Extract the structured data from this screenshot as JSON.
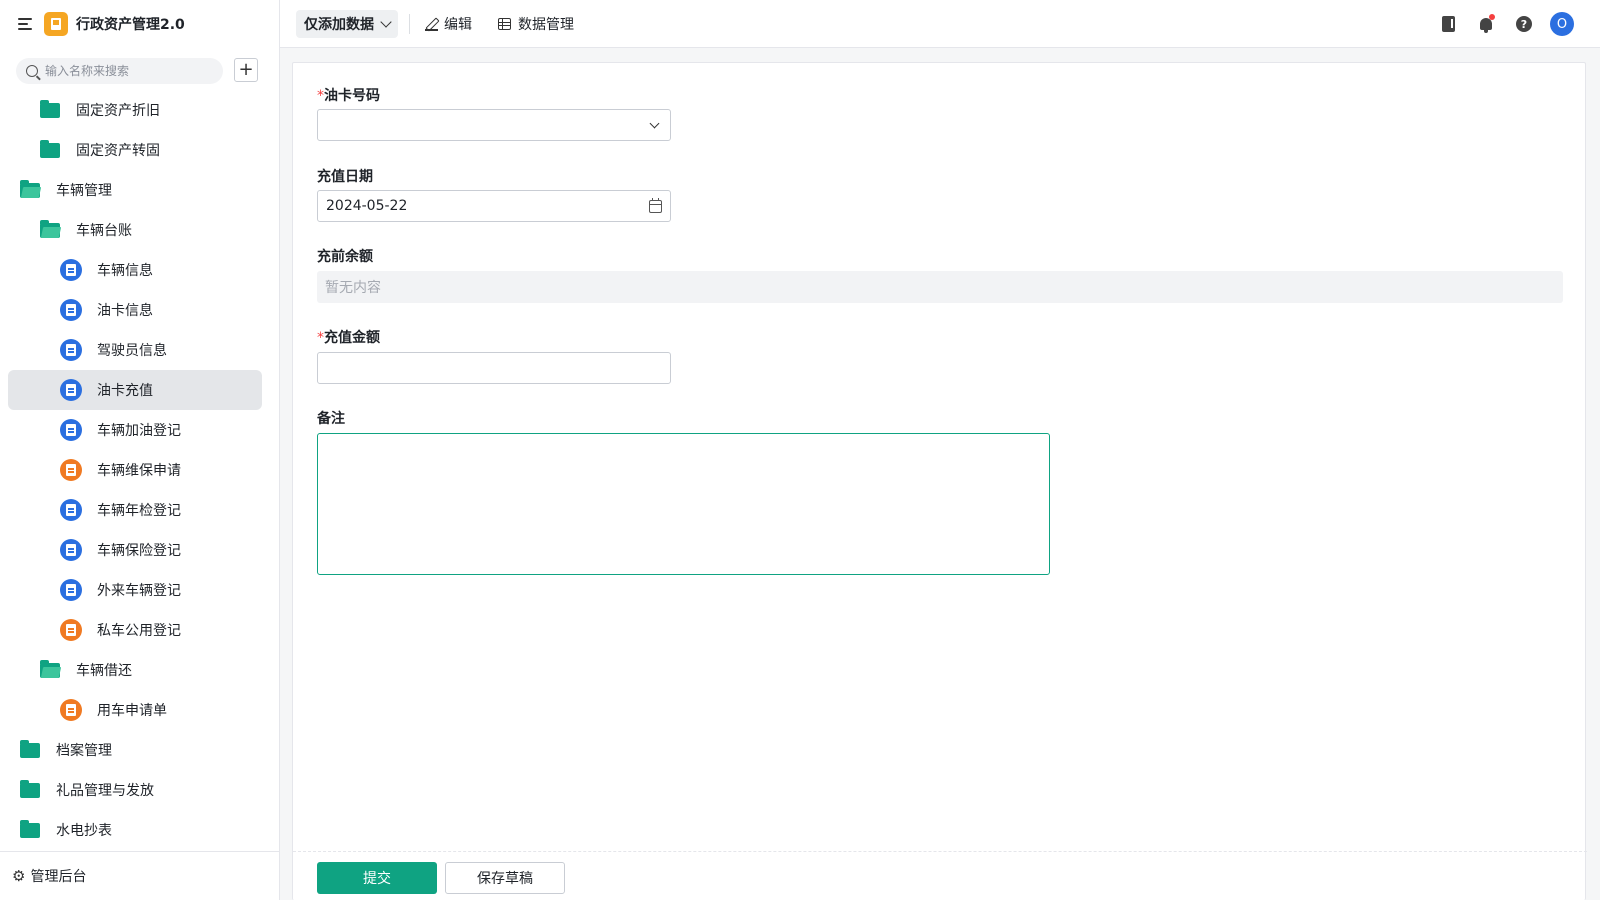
{
  "app": {
    "title": "行政资产管理2.0"
  },
  "search": {
    "placeholder": "输入名称来搜索"
  },
  "sidebar": {
    "items": [
      {
        "label": "固定资产折旧",
        "type": "folder",
        "level": 1
      },
      {
        "label": "固定资产转固",
        "type": "folder",
        "level": 1
      },
      {
        "label": "车辆管理",
        "type": "folder-open",
        "level": 0
      },
      {
        "label": "车辆台账",
        "type": "folder-open",
        "level": 1
      },
      {
        "label": "车辆信息",
        "type": "doc-blue",
        "level": 2
      },
      {
        "label": "油卡信息",
        "type": "doc-blue",
        "level": 2
      },
      {
        "label": "驾驶员信息",
        "type": "doc-blue",
        "level": 2
      },
      {
        "label": "油卡充值",
        "type": "doc-blue",
        "level": 2,
        "active": true
      },
      {
        "label": "车辆加油登记",
        "type": "doc-blue",
        "level": 2
      },
      {
        "label": "车辆维保申请",
        "type": "doc-orange",
        "level": 2
      },
      {
        "label": "车辆年检登记",
        "type": "doc-blue",
        "level": 2
      },
      {
        "label": "车辆保险登记",
        "type": "doc-blue",
        "level": 2
      },
      {
        "label": "外来车辆登记",
        "type": "doc-blue",
        "level": 2
      },
      {
        "label": "私车公用登记",
        "type": "doc-orange",
        "level": 2
      },
      {
        "label": "车辆借还",
        "type": "folder-open",
        "level": 1
      },
      {
        "label": "用车申请单",
        "type": "doc-orange",
        "level": 2
      },
      {
        "label": "档案管理",
        "type": "folder",
        "level": 0
      },
      {
        "label": "礼品管理与发放",
        "type": "folder",
        "level": 0
      },
      {
        "label": "水电抄表",
        "type": "folder",
        "level": 0
      }
    ],
    "footer": {
      "label": "管理后台"
    }
  },
  "toolbar": {
    "view_label": "仅添加数据",
    "edit_label": "编辑",
    "data_manage_label": "数据管理",
    "avatar_initial": "O",
    "icons": [
      "book-icon",
      "bell-icon",
      "help-icon",
      "avatar"
    ]
  },
  "form": {
    "card_no": {
      "label": "油卡号码",
      "required": true,
      "value": ""
    },
    "recharge_date": {
      "label": "充值日期",
      "value": "2024-05-22"
    },
    "balance_before": {
      "label": "充前余额",
      "placeholder": "暂无内容"
    },
    "amount": {
      "label": "充值金额",
      "required": true,
      "value": ""
    },
    "remark": {
      "label": "备注",
      "value": ""
    },
    "submit_label": "提交",
    "draft_label": "保存草稿"
  },
  "colors": {
    "accent": "#0fa382",
    "folder": "#0fa382",
    "doc_blue": "#2b6fe0",
    "doc_orange": "#f07a22",
    "logo": "#f5a623",
    "required": "#f53f3f"
  }
}
